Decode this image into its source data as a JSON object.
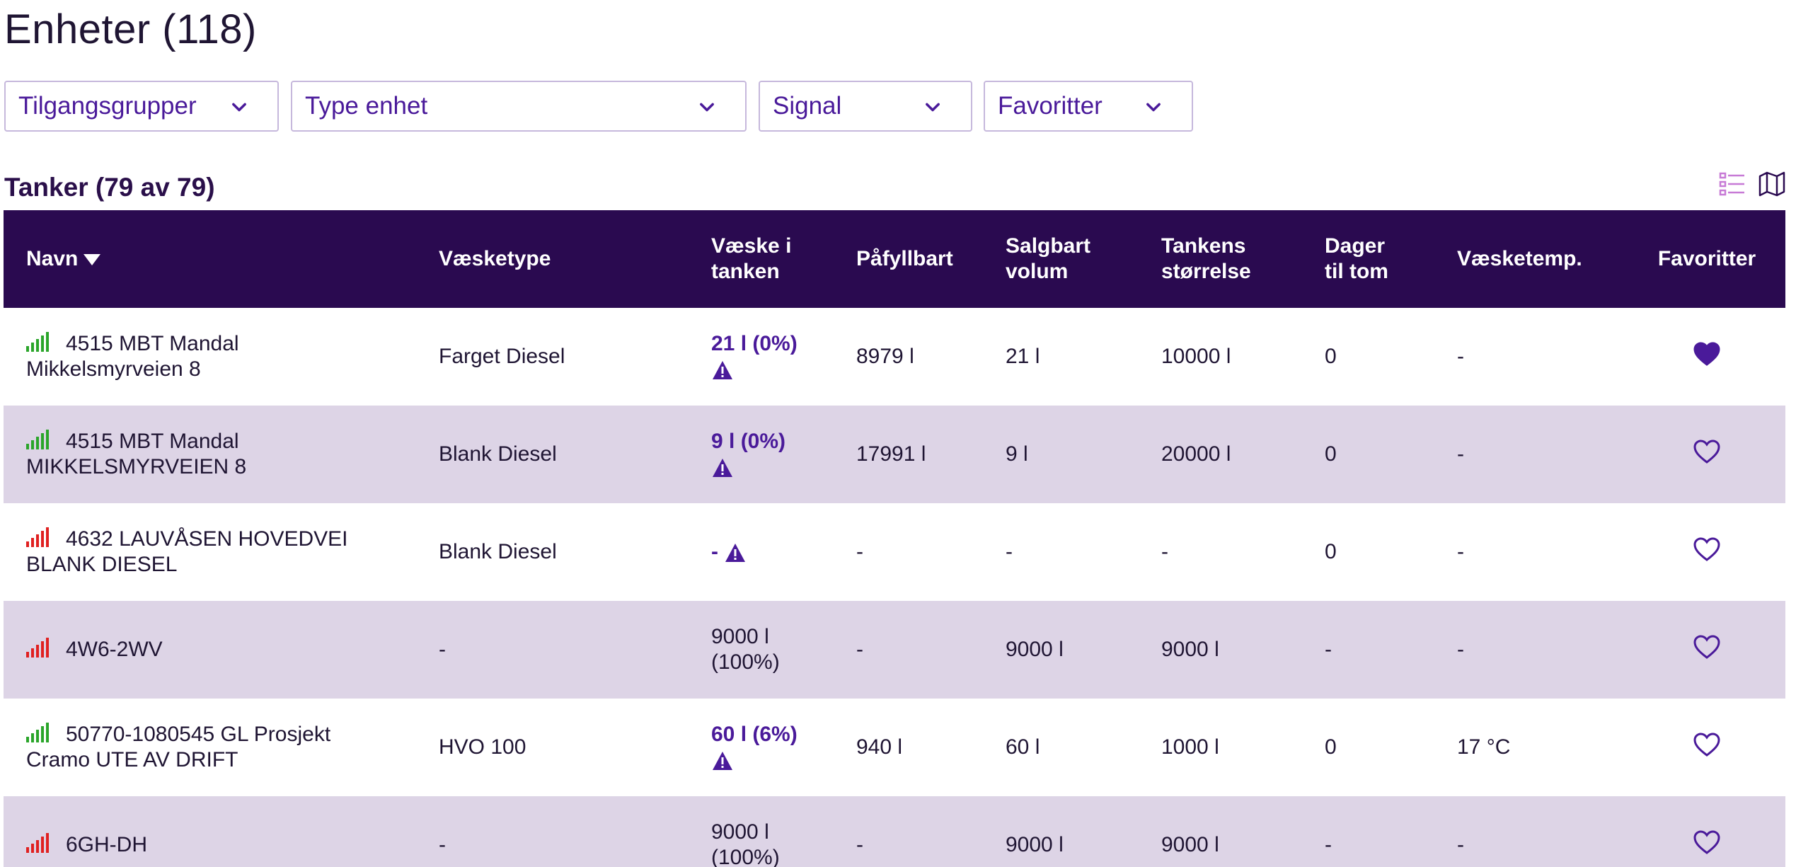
{
  "page": {
    "title": "Enheter (118)"
  },
  "filters": [
    {
      "label": "Tilgangsgrupper"
    },
    {
      "label": "Type enhet"
    },
    {
      "label": "Signal"
    },
    {
      "label": "Favoritter"
    }
  ],
  "section": {
    "title": "Tanker (79 av 79)"
  },
  "view_toggles": {
    "list_icon": "list-icon",
    "map_icon": "map-icon"
  },
  "colors": {
    "brand_dark": "#2a0a50",
    "accent": "#4a1a9a",
    "row_alt": "#ddd4e6",
    "signal_good": "#2aa52a",
    "signal_bad": "#e02020"
  },
  "table": {
    "headers": {
      "name": "Navn",
      "fluid_type": "Væsketype",
      "fluid_in_tank_1": "Væske i",
      "fluid_in_tank_2": "tanken",
      "refillable": "Påfyllbart",
      "sellable_1": "Salgbart",
      "sellable_2": "volum",
      "size_1": "Tankens",
      "size_2": "størrelse",
      "days_1": "Dager",
      "days_2": "til tom",
      "temp": "Væsketemp.",
      "favorites": "Favoritter"
    },
    "rows": [
      {
        "signal": "good",
        "name_1": "4515 MBT Mandal",
        "name_2": "Mikkelsmyrveien 8",
        "fluid_type": "Farget Diesel",
        "level": "21 l (0%)",
        "level_2": "",
        "alert": true,
        "refillable": "8979 l",
        "sellable": "21 l",
        "size": "10000 l",
        "days": "0",
        "temp": "-",
        "favorite": true
      },
      {
        "signal": "good",
        "name_1": "4515 MBT Mandal",
        "name_2": "MIKKELSMYRVEIEN 8",
        "fluid_type": "Blank Diesel",
        "level": "9 l (0%)",
        "level_2": "",
        "alert": true,
        "refillable": "17991 l",
        "sellable": "9 l",
        "size": "20000 l",
        "days": "0",
        "temp": "-",
        "favorite": false
      },
      {
        "signal": "bad",
        "name_1": "4632 LAUVÅSEN HOVEDVEI",
        "name_2": "BLANK DIESEL",
        "fluid_type": "Blank Diesel",
        "level": "-",
        "level_2": "",
        "alert": true,
        "refillable": "-",
        "sellable": "-",
        "size": "-",
        "days": "0",
        "temp": "-",
        "favorite": false
      },
      {
        "signal": "bad",
        "name_1": "4W6-2WV",
        "name_2": "",
        "fluid_type": "-",
        "level": "9000 l",
        "level_2": "(100%)",
        "alert": false,
        "refillable": "-",
        "sellable": "9000 l",
        "size": "9000 l",
        "days": "-",
        "temp": "-",
        "favorite": false
      },
      {
        "signal": "good",
        "name_1": "50770-1080545 GL Prosjekt",
        "name_2": "Cramo UTE AV DRIFT",
        "fluid_type": "HVO 100",
        "level": "60 l (6%)",
        "level_2": "",
        "alert": true,
        "refillable": "940 l",
        "sellable": "60 l",
        "size": "1000 l",
        "days": "0",
        "temp": "17 °C",
        "favorite": false
      },
      {
        "signal": "bad",
        "name_1": "6GH-DH",
        "name_2": "",
        "fluid_type": "-",
        "level": "9000 l",
        "level_2": "(100%)",
        "alert": false,
        "refillable": "-",
        "sellable": "9000 l",
        "size": "9000 l",
        "days": "-",
        "temp": "-",
        "favorite": false
      }
    ]
  }
}
